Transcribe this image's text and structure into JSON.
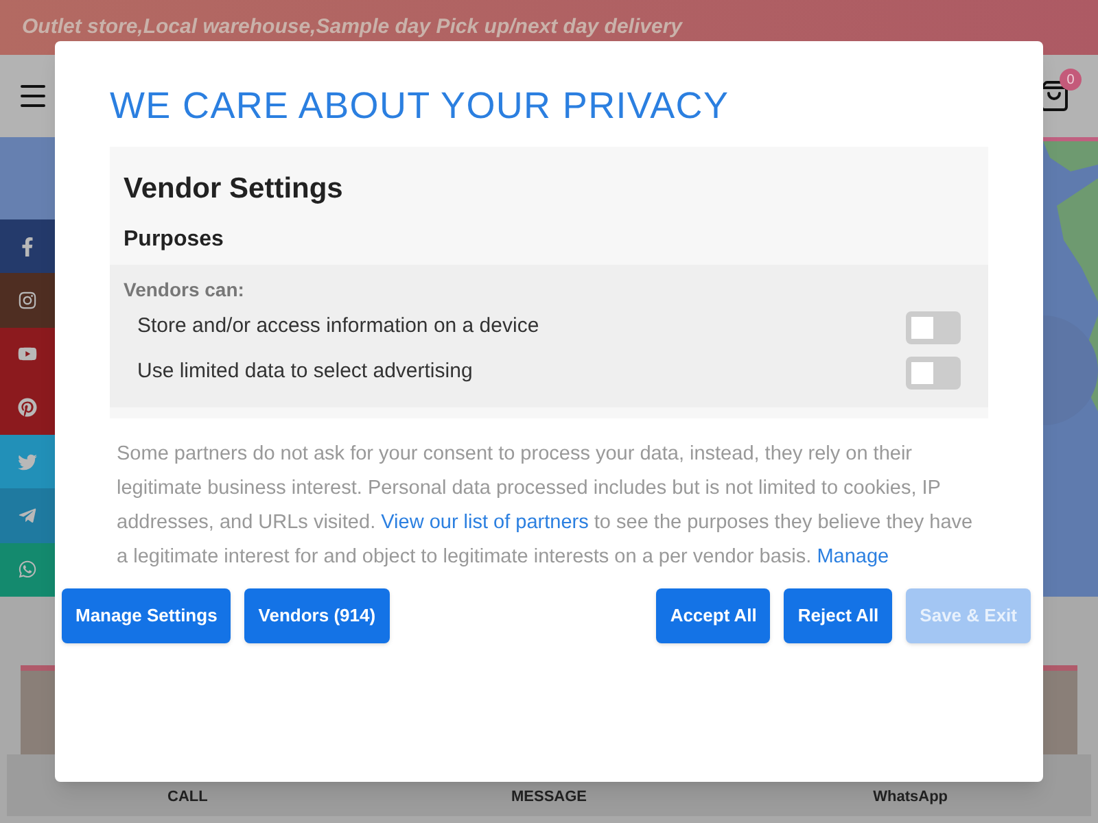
{
  "banner": {
    "text": "Outlet store,Local warehouse,Sample day Pick up/next day delivery"
  },
  "header": {
    "cart_count": "0"
  },
  "social_links": [
    {
      "kind": "facebook"
    },
    {
      "kind": "instagram"
    },
    {
      "kind": "youtube"
    },
    {
      "kind": "pinterest"
    },
    {
      "kind": "twitter"
    },
    {
      "kind": "telegram"
    },
    {
      "kind": "whatsapp"
    }
  ],
  "bottom_bar": [
    {
      "label": "CALL"
    },
    {
      "label": "MESSAGE"
    },
    {
      "label": "WhatsApp"
    }
  ],
  "dialog": {
    "title": "WE CARE ABOUT YOUR PRIVACY",
    "section_title": "Vendor Settings",
    "subsection": "Purposes",
    "group_label": "Vendors can:",
    "purposes": [
      {
        "label": "Store and/or access information on a device",
        "on": false
      },
      {
        "label": "Use limited data to select advertising",
        "on": false
      }
    ],
    "notice": [
      {
        "kind": "text",
        "text": "Some partners do not ask for your consent to process your data, instead, they rely on their legitimate business interest. Personal data processed includes but is not limited to cookies, IP addresses, and URLs visited. "
      },
      {
        "kind": "link",
        "text": "View our list of partners"
      },
      {
        "kind": "text",
        "text": " to see the purposes they believe they have a legitimate interest for and object to legitimate interests on a per vendor basis. "
      },
      {
        "kind": "link",
        "text": "Manage"
      }
    ],
    "left_buttons": [
      {
        "label": "Manage Settings",
        "disabled": false
      },
      {
        "label": "Vendors (914)",
        "disabled": false
      }
    ],
    "right_buttons": [
      {
        "label": "Accept All",
        "disabled": false
      },
      {
        "label": "Reject All",
        "disabled": false
      },
      {
        "label": "Save & Exit",
        "disabled": true
      }
    ]
  }
}
